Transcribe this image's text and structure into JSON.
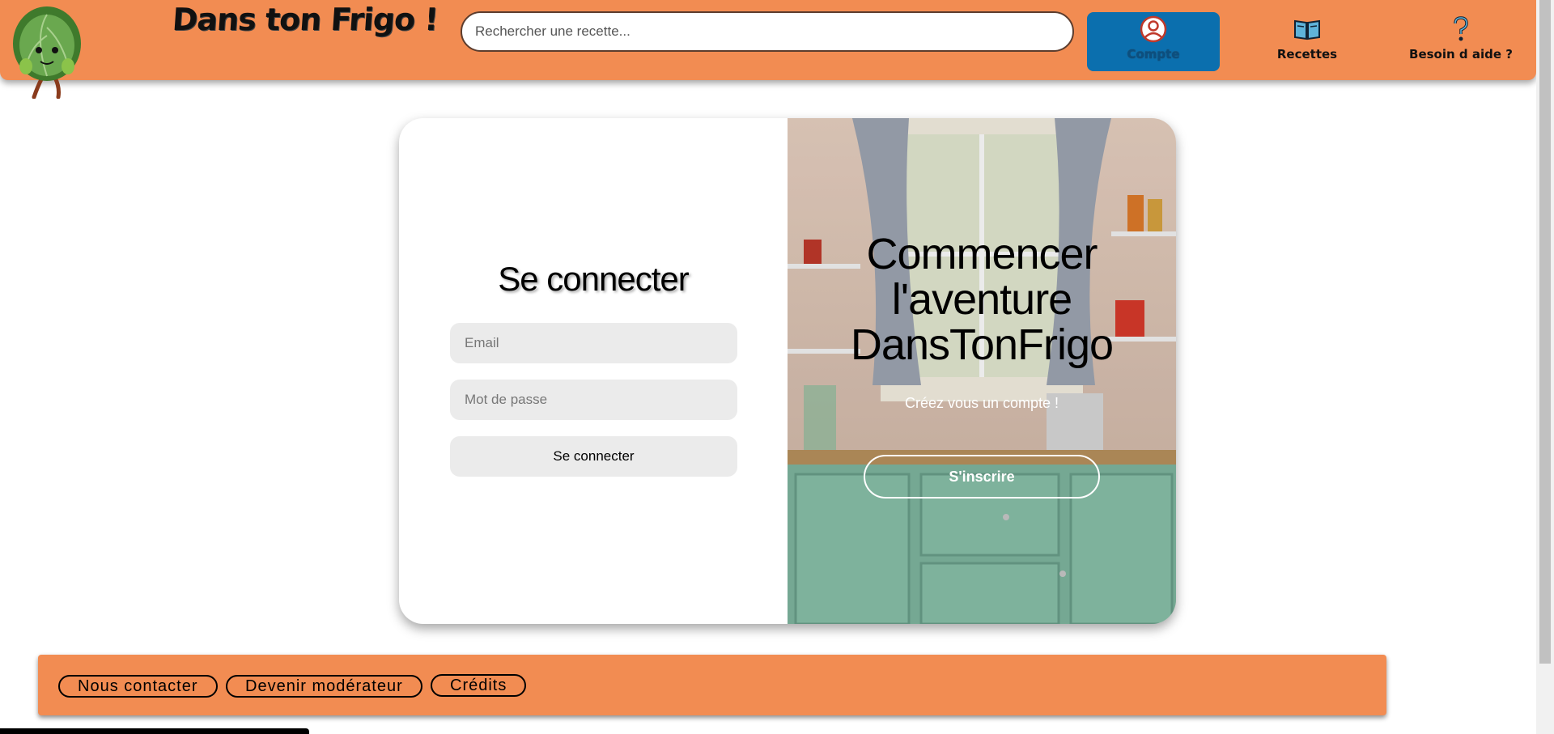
{
  "header": {
    "brand": "Dans ton Frigo !",
    "search_placeholder": "Rechercher une recette...",
    "nav": [
      {
        "label": "Compte",
        "icon": "user-icon",
        "active": true
      },
      {
        "label": "Recettes",
        "icon": "book-icon",
        "active": false
      },
      {
        "label": "Besoin d aide ?",
        "icon": "question-icon",
        "active": false
      }
    ]
  },
  "login": {
    "title": "Se connecter",
    "email_placeholder": "Email",
    "password_placeholder": "Mot de passe",
    "submit_label": "Se connecter"
  },
  "signup": {
    "title_lines": [
      "Commencer",
      "l'aventure",
      "DansTonFrigo"
    ],
    "subtitle": "Créez vous un compte !",
    "button_label": "S'inscrire"
  },
  "footer": {
    "buttons": [
      "Nous contacter",
      "Devenir modérateur",
      "Crédits"
    ]
  },
  "colors": {
    "accent_orange": "#f28c52",
    "active_blue": "#0b6fae",
    "input_gray": "#ebebeb"
  }
}
